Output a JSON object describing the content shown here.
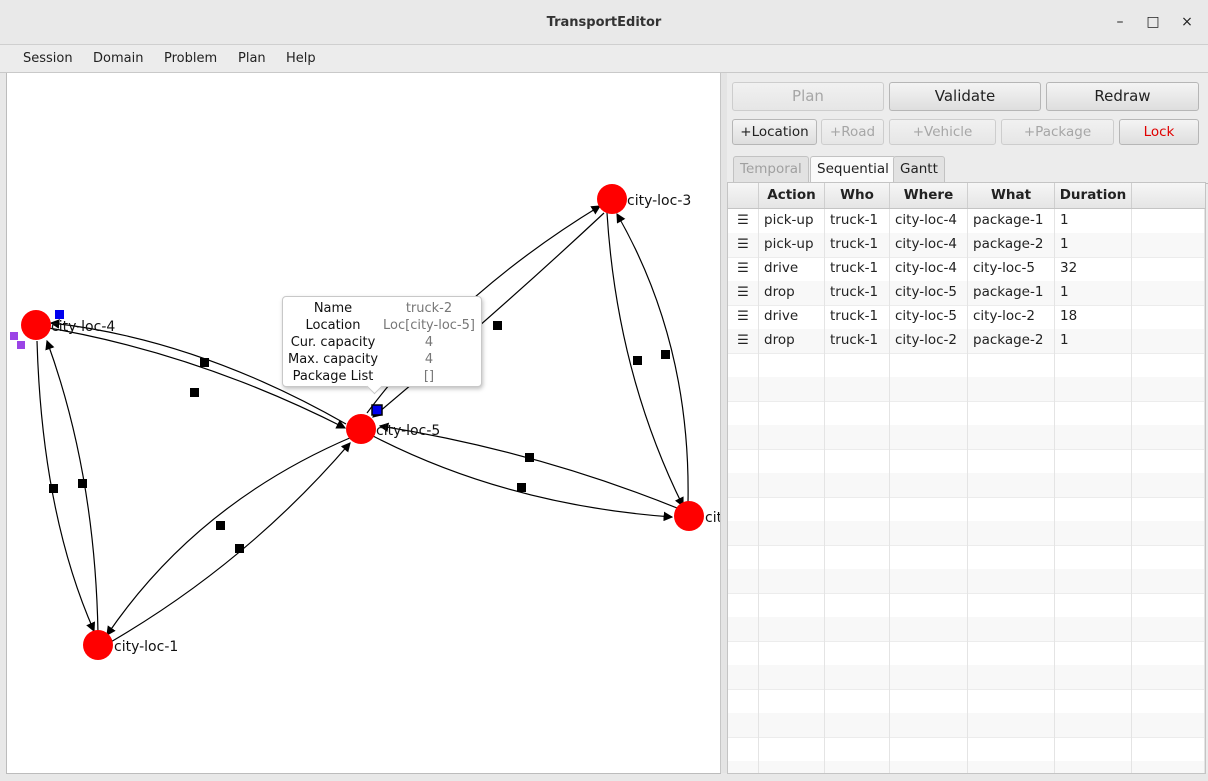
{
  "window": {
    "title": "TransportEditor",
    "minimize_glyph": "–",
    "maximize_glyph": "□",
    "close_glyph": "×"
  },
  "menu": [
    "Session",
    "Domain",
    "Problem",
    "Plan",
    "Help"
  ],
  "actions": {
    "plan": "Plan",
    "validate": "Validate",
    "redraw": "Redraw",
    "add_location": "+Location",
    "add_road": "+Road",
    "add_vehicle": "+Vehicle",
    "add_package": "+Package",
    "lock": "Lock"
  },
  "tabs": [
    "Temporal",
    "Sequential",
    "Gantt"
  ],
  "table": {
    "columns": [
      "Action",
      "Who",
      "Where",
      "What",
      "Duration"
    ],
    "handle_glyph": "☰",
    "rows": [
      [
        "pick-up",
        "truck-1",
        "city-loc-4",
        "package-1",
        "1"
      ],
      [
        "pick-up",
        "truck-1",
        "city-loc-4",
        "package-2",
        "1"
      ],
      [
        "drive",
        "truck-1",
        "city-loc-4",
        "city-loc-5",
        "32"
      ],
      [
        "drop",
        "truck-1",
        "city-loc-5",
        "package-1",
        "1"
      ],
      [
        "drive",
        "truck-1",
        "city-loc-5",
        "city-loc-2",
        "18"
      ],
      [
        "drop",
        "truck-1",
        "city-loc-2",
        "package-2",
        "1"
      ]
    ]
  },
  "graph": {
    "nodes": [
      "city-loc-3",
      "city-loc-4",
      "city-loc-5",
      "city-loc-1",
      "cit"
    ]
  },
  "tooltip": {
    "name_label": "Name",
    "name_value": "truck-2",
    "location_label": "Location",
    "location_value": "Loc[city-loc-5]",
    "cur_label": "Cur. capacity",
    "cur_value": "4",
    "max_label": "Max. capacity",
    "max_value": "4",
    "pkg_label": "Package List",
    "pkg_value": "[]"
  },
  "colors": {
    "node": "#ff0000",
    "vehicle": "#0000ee",
    "package": "#9b44e6",
    "lock_text": "#e00000"
  }
}
